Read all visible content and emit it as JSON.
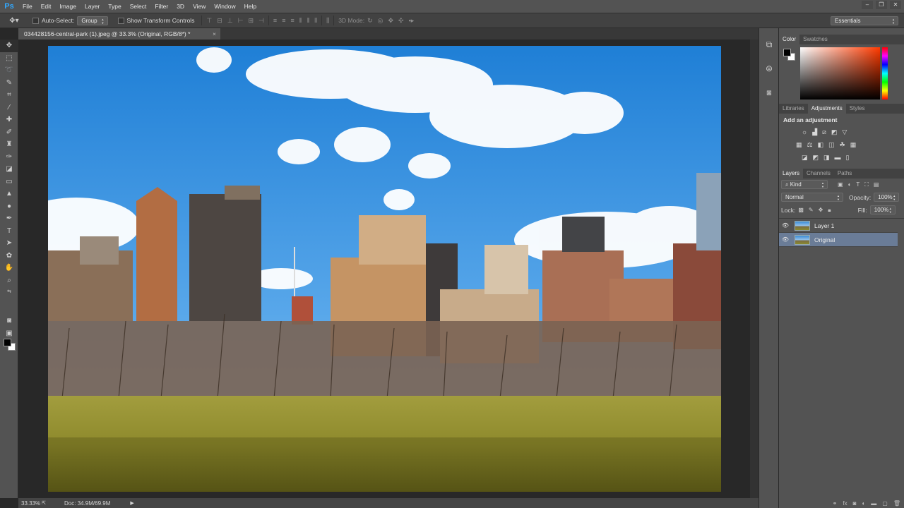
{
  "app": {
    "logo": "Ps"
  },
  "menu": [
    "File",
    "Edit",
    "Image",
    "Layer",
    "Type",
    "Select",
    "Filter",
    "3D",
    "View",
    "Window",
    "Help"
  ],
  "window_controls": {
    "minimize": "–",
    "restore": "❐",
    "close": "✕"
  },
  "options_bar": {
    "auto_select_label": "Auto-Select:",
    "auto_select_value": "Group",
    "show_transform_label": "Show Transform Controls",
    "mode_3d_label": "3D Mode:",
    "workspace": "Essentials"
  },
  "document_tab": {
    "title": "034428156-central-park (1).jpeg @ 33.3% (Original, RGB/8*) *",
    "close": "×"
  },
  "status_bar": {
    "zoom": "33.33%",
    "doc_info": "Doc: 34.9M/69.9M"
  },
  "panels": {
    "color_tabs": [
      "Color",
      "Swatches"
    ],
    "adjustments_tabs": [
      "Libraries",
      "Adjustments",
      "Styles"
    ],
    "adjustments_title": "Add an adjustment",
    "layers_tabs": [
      "Layers",
      "Channels",
      "Paths"
    ],
    "kind_filter": "Kind",
    "blend_mode": "Normal",
    "opacity_label": "Opacity:",
    "opacity_value": "100%",
    "lock_label": "Lock:",
    "fill_label": "Fill:",
    "fill_value": "100%"
  },
  "layers": [
    {
      "name": "Layer 1",
      "selected": false
    },
    {
      "name": "Original",
      "selected": true
    }
  ],
  "colors": {
    "foreground": "#000000",
    "background": "#ffffff",
    "selection_highlight": "#6a7c97"
  }
}
